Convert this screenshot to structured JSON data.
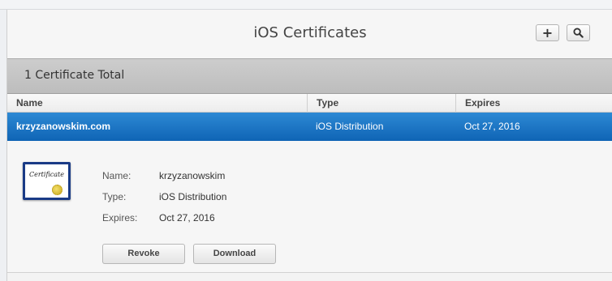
{
  "header": {
    "title": "iOS Certificates",
    "add_icon": "plus-icon",
    "search_icon": "magnifier-icon"
  },
  "summary": {
    "text": "1 Certificate Total"
  },
  "table": {
    "columns": [
      "Name",
      "Type",
      "Expires"
    ],
    "rows": [
      {
        "name": "krzyzanowskim.com",
        "type": "iOS Distribution",
        "expires": "Oct 27, 2016"
      }
    ]
  },
  "detail": {
    "icon": "certificate-icon",
    "icon_text": "Certificate",
    "name_label": "Name:",
    "name_value": "krzyzanowskim",
    "type_label": "Type:",
    "type_value": "iOS Distribution",
    "expires_label": "Expires:",
    "expires_value": "Oct 27, 2016",
    "revoke_label": "Revoke",
    "download_label": "Download"
  },
  "colors": {
    "selection": "#1a74c6",
    "summary_bar": "#c6c6c6",
    "certificate_border": "#1a3b86"
  }
}
